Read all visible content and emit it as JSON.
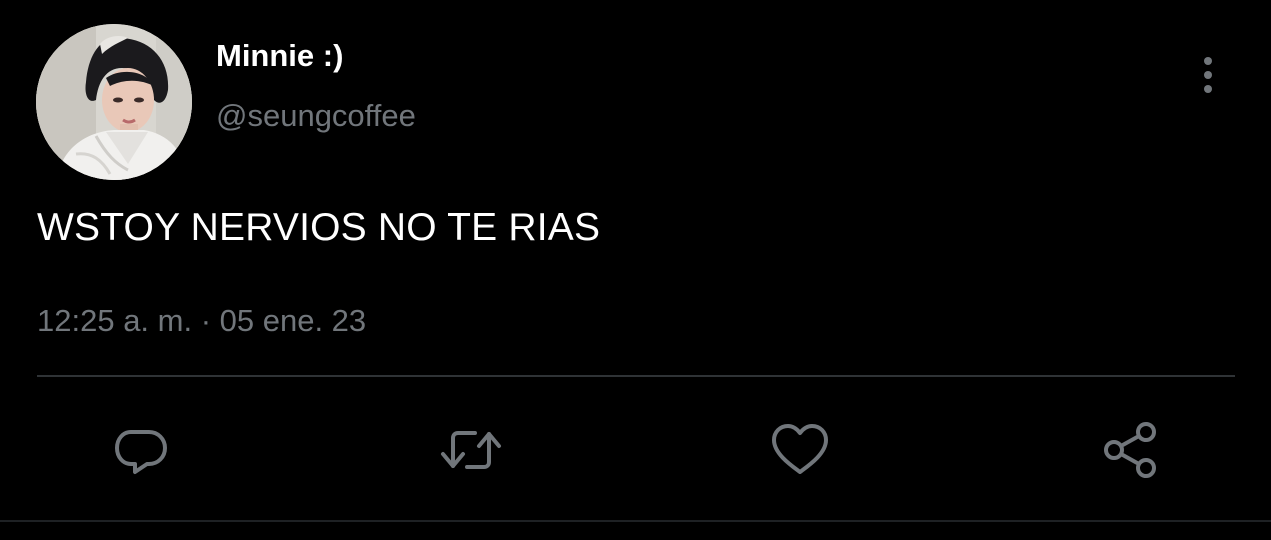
{
  "user": {
    "display_name": "Minnie :)",
    "handle": "@seungcoffee",
    "avatar_icon": "profile-photo"
  },
  "tweet": {
    "text": "WSTOY NERVIOS NO TE RIAS",
    "timestamp": "12:25 a. m. · 05 ene. 23"
  },
  "actions": [
    {
      "name": "reply",
      "icon": "speech-bubble-icon"
    },
    {
      "name": "retweet",
      "icon": "retweet-arrows-icon"
    },
    {
      "name": "like",
      "icon": "heart-icon"
    },
    {
      "name": "share",
      "icon": "share-nodes-icon"
    }
  ],
  "more_icon": "vertical-dots-icon",
  "colors": {
    "background": "#000000",
    "primary_text": "#ffffff",
    "secondary_text": "#71767b",
    "icon": "#71767b",
    "divider": "#2f3336"
  }
}
